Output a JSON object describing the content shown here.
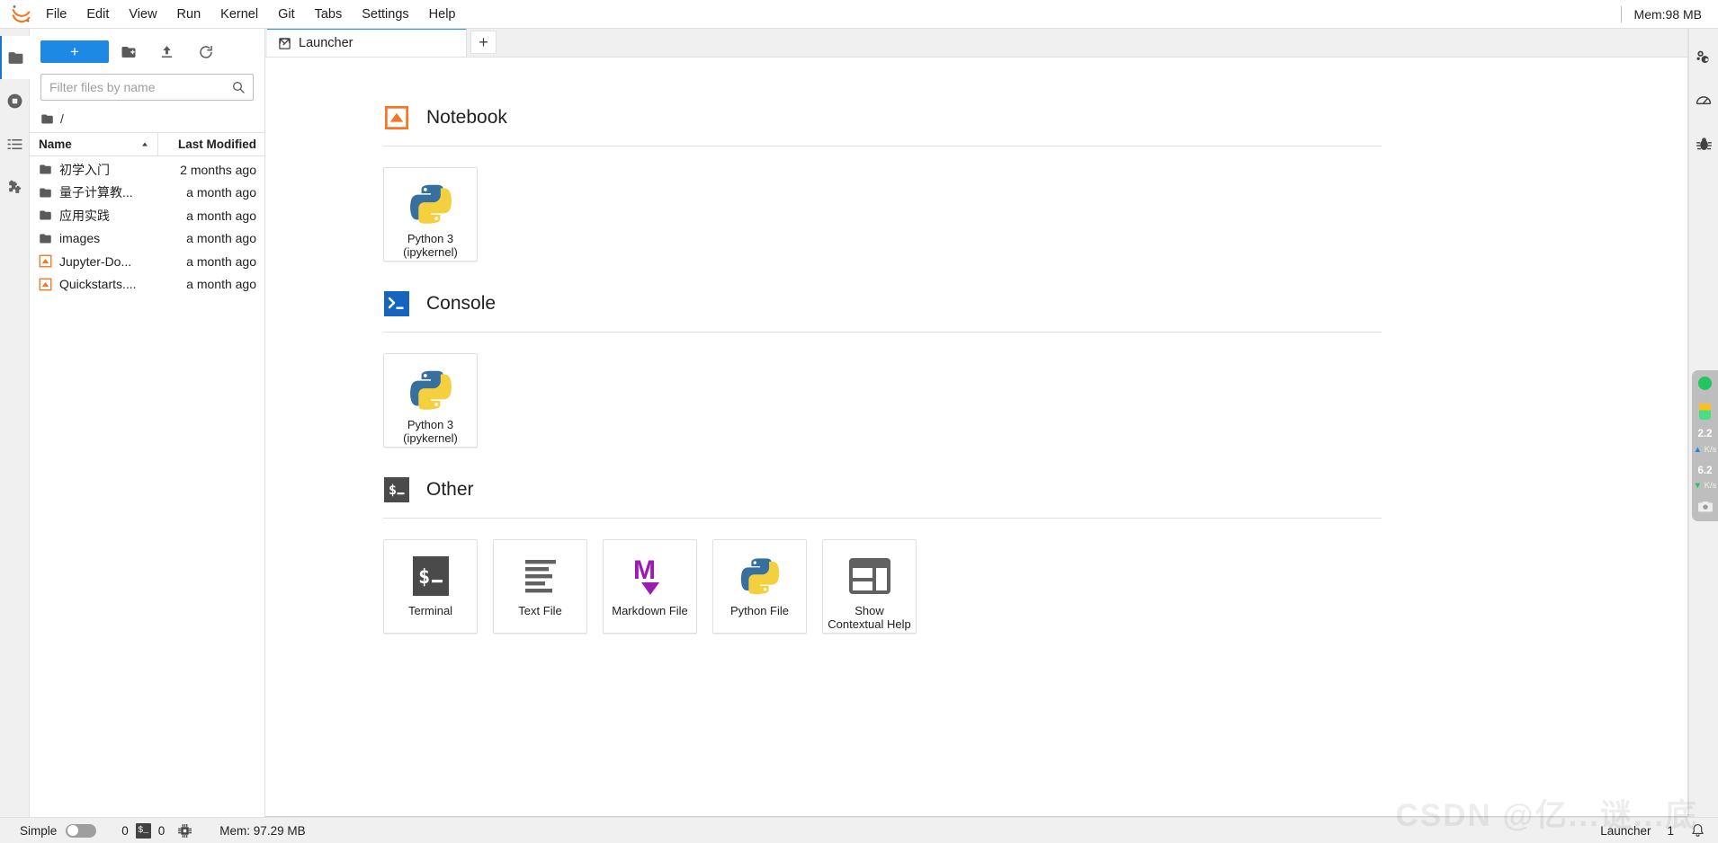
{
  "app": {
    "logo_icon": "jupyter-logo-icon",
    "mem_indicator": "Mem:98 MB"
  },
  "menubar": {
    "items": [
      {
        "label": "File",
        "name": "menu-file"
      },
      {
        "label": "Edit",
        "name": "menu-edit"
      },
      {
        "label": "View",
        "name": "menu-view"
      },
      {
        "label": "Run",
        "name": "menu-run"
      },
      {
        "label": "Kernel",
        "name": "menu-kernel"
      },
      {
        "label": "Git",
        "name": "menu-git"
      },
      {
        "label": "Tabs",
        "name": "menu-tabs"
      },
      {
        "label": "Settings",
        "name": "menu-settings"
      },
      {
        "label": "Help",
        "name": "menu-help"
      }
    ]
  },
  "left_rail": {
    "items": [
      {
        "name": "sidebar-file-browser",
        "icon": "folder-icon",
        "active": true
      },
      {
        "name": "sidebar-running",
        "icon": "stop-circle-icon",
        "active": false
      },
      {
        "name": "sidebar-toc",
        "icon": "list-icon",
        "active": false
      },
      {
        "name": "sidebar-extensions",
        "icon": "puzzle-icon",
        "active": false
      }
    ]
  },
  "filebrowser": {
    "new_launcher_label": "+",
    "toolbar": [
      {
        "name": "new-folder-button",
        "icon": "new-folder-icon"
      },
      {
        "name": "upload-button",
        "icon": "upload-icon"
      },
      {
        "name": "refresh-button",
        "icon": "refresh-icon"
      }
    ],
    "filter": {
      "placeholder": "Filter files by name",
      "value": "",
      "icon": "search-icon"
    },
    "breadcrumb": "/",
    "columns": {
      "name": "Name",
      "last_modified": "Last Modified",
      "sort_indicator": "sort-asc-icon"
    },
    "rows": [
      {
        "icon": "folder-icon",
        "name": "初学入门",
        "modified": "2 months ago"
      },
      {
        "icon": "folder-icon",
        "name": "量子计算教...",
        "modified": "a month ago"
      },
      {
        "icon": "folder-icon",
        "name": "应用实践",
        "modified": "a month ago"
      },
      {
        "icon": "folder-icon",
        "name": "images",
        "modified": "a month ago"
      },
      {
        "icon": "notebook-icon",
        "name": "Jupyter-Do...",
        "modified": "a month ago"
      },
      {
        "icon": "notebook-icon",
        "name": "Quickstarts....",
        "modified": "a month ago"
      }
    ]
  },
  "dock": {
    "tabs": [
      {
        "label": "Launcher",
        "icon": "launcher-icon",
        "active": true
      }
    ],
    "add_tab_label": "+"
  },
  "launcher": {
    "sections": [
      {
        "title": "Notebook",
        "icon": "notebook-icon",
        "cards": [
          {
            "label": "Python 3\n(ipykernel)",
            "line1": "Python 3",
            "line2": "(ipykernel)",
            "icon": "python-icon",
            "name": "card-notebook-python3"
          }
        ]
      },
      {
        "title": "Console",
        "icon": "console-icon",
        "cards": [
          {
            "label": "Python 3\n(ipykernel)",
            "line1": "Python 3",
            "line2": "(ipykernel)",
            "icon": "python-icon",
            "name": "card-console-python3"
          }
        ]
      },
      {
        "title": "Other",
        "icon": "terminal-icon",
        "cards": [
          {
            "line1": "Terminal",
            "line2": "",
            "icon": "terminal-icon",
            "name": "card-terminal"
          },
          {
            "line1": "Text File",
            "line2": "",
            "icon": "text-file-icon",
            "name": "card-text-file"
          },
          {
            "line1": "Markdown File",
            "line2": "",
            "icon": "markdown-icon",
            "name": "card-markdown-file"
          },
          {
            "line1": "Python File",
            "line2": "",
            "icon": "python-icon",
            "name": "card-python-file"
          },
          {
            "line1": "Show Contextual",
            "line2": "Help",
            "icon": "contextual-help-icon",
            "name": "card-contextual-help"
          }
        ]
      }
    ]
  },
  "right_rail": {
    "items": [
      {
        "name": "property-inspector",
        "icon": "gears-icon"
      },
      {
        "name": "performance-monitor",
        "icon": "gauge-icon"
      },
      {
        "name": "debugger",
        "icon": "bug-icon"
      }
    ],
    "float_widget": {
      "status_dot_color": "#22c55e",
      "upload_speed": "2.2",
      "upload_unit": "K/s",
      "download_speed": "6.2",
      "download_unit": "K/s",
      "camera_icon": "camera-icon"
    }
  },
  "statusbar": {
    "simple_label": "Simple",
    "simple_on": false,
    "kernel_count": "0",
    "terminal_badge_icon": "terminal-icon",
    "terminal_count": "0",
    "cpu_icon": "cpu-icon",
    "memory": "Mem: 97.29 MB",
    "active_item": "Launcher",
    "notification_count": "1",
    "bell_icon": "bell-icon"
  },
  "watermark": "CSDN @亿...谜...底"
}
